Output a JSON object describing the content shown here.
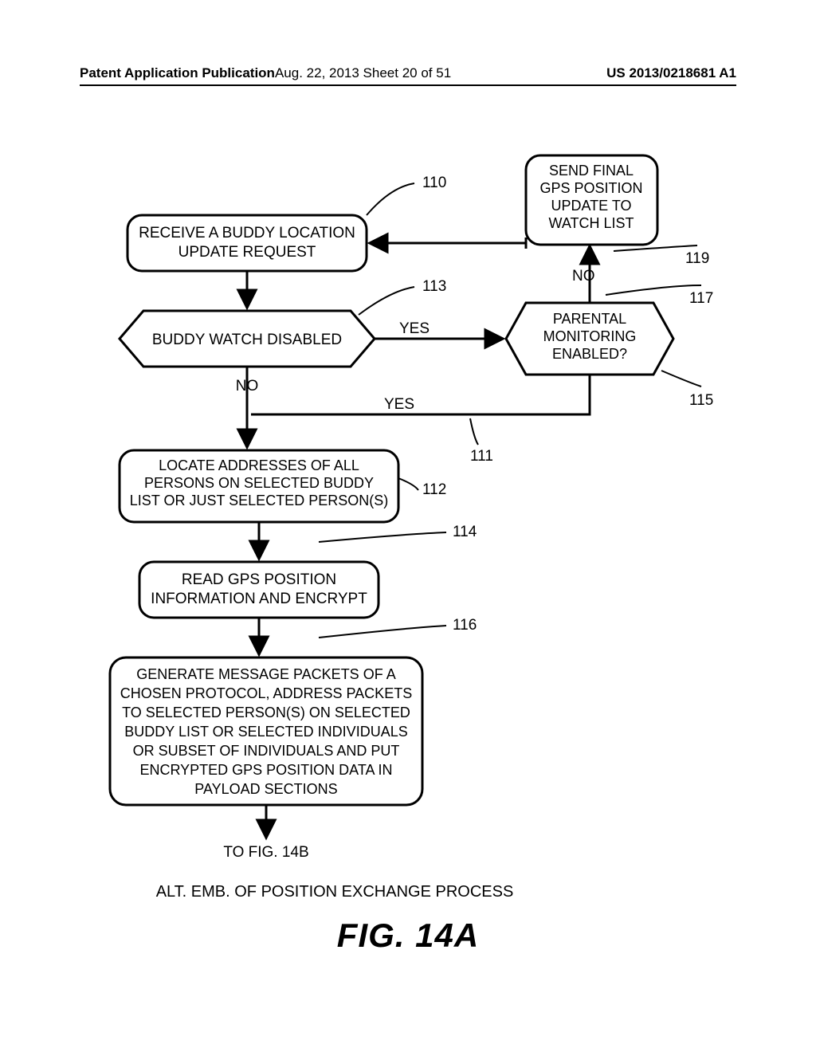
{
  "header": {
    "left": "Patent Application Publication",
    "center": "Aug. 22, 2013  Sheet 20 of 51",
    "right": "US 2013/0218681 A1"
  },
  "blocks": {
    "b110": {
      "line1": "RECEIVE A BUDDY LOCATION",
      "line2": "UPDATE REQUEST"
    },
    "b113": "BUDDY WATCH DISABLED",
    "b115": {
      "line1": "PARENTAL",
      "line2": "MONITORING",
      "line3": "ENABLED?"
    },
    "b119": {
      "line1": "SEND FINAL",
      "line2": "GPS POSITION",
      "line3": "UPDATE TO",
      "line4": "WATCH LIST"
    },
    "b112": {
      "line1": "LOCATE ADDRESSES OF ALL",
      "line2": "PERSONS ON SELECTED BUDDY",
      "line3": "LIST OR JUST SELECTED PERSON(S)"
    },
    "b114": {
      "line1": "READ GPS POSITION",
      "line2": "INFORMATION AND ENCRYPT"
    },
    "b116": {
      "line1": "GENERATE MESSAGE PACKETS OF A",
      "line2": "CHOSEN PROTOCOL, ADDRESS PACKETS",
      "line3": "TO SELECTED PERSON(S) ON SELECTED",
      "line4": "BUDDY LIST OR SELECTED INDIVIDUALS",
      "line5": "OR SUBSET OF INDIVIDUALS AND PUT",
      "line6": "ENCRYPTED GPS POSITION DATA IN",
      "line7": "PAYLOAD SECTIONS"
    }
  },
  "labels": {
    "l110": "110",
    "l113": "113",
    "l115": "115",
    "l117": "117",
    "l119": "119",
    "l111": "111",
    "l112": "112",
    "l114": "114",
    "l116": "116",
    "yes": "YES",
    "no": "NO",
    "tofig": "TO FIG. 14B",
    "caption": "ALT. EMB. OF POSITION EXCHANGE PROCESS",
    "figno": "FIG. 14A"
  }
}
